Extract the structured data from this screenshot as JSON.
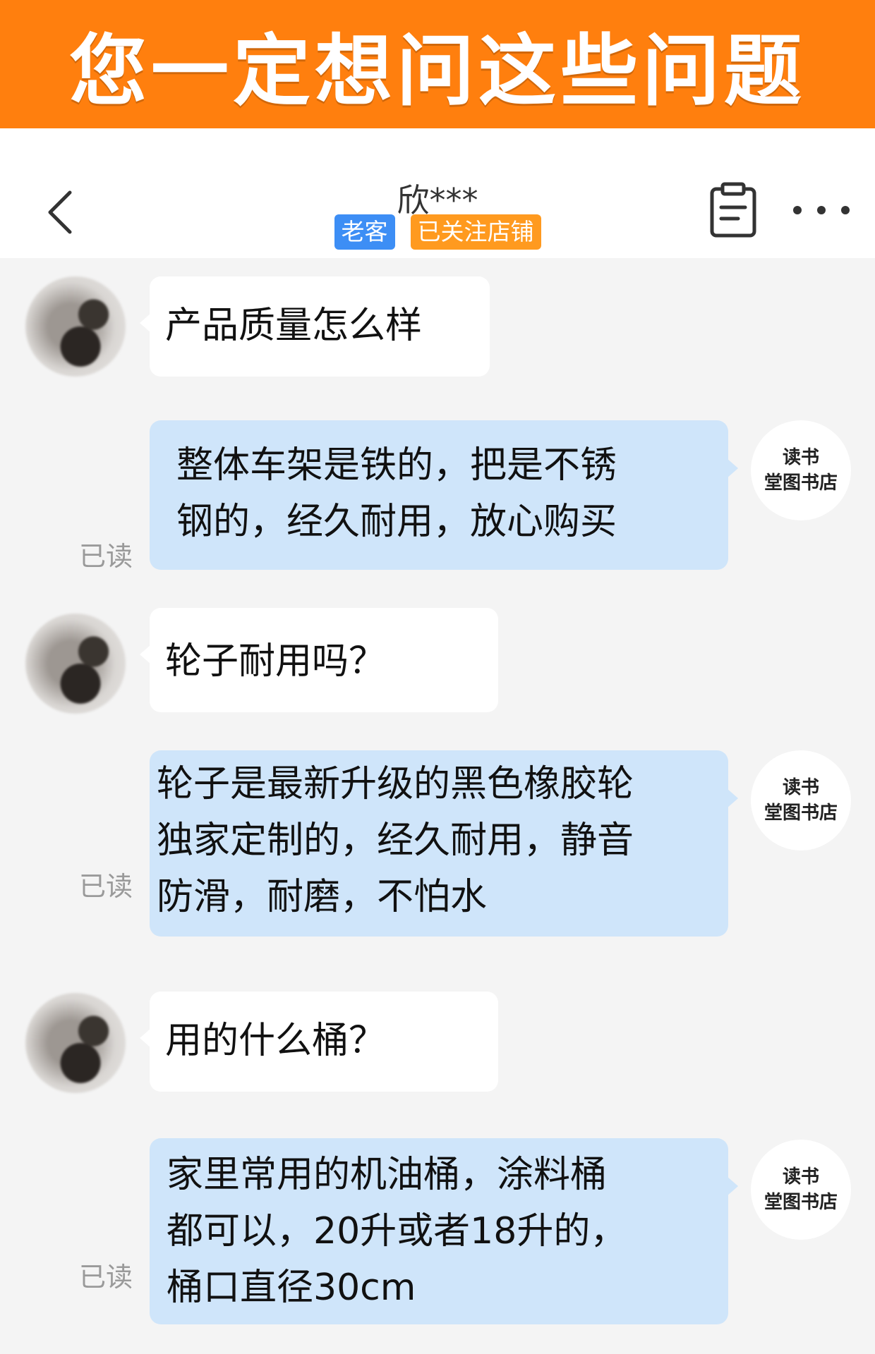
{
  "banner": {
    "title": "您一定想问这些问题"
  },
  "header": {
    "back_icon": "chevron-left-icon",
    "contact_name": "欣***",
    "tags": [
      {
        "label": "老客",
        "color": "#3d8ef5"
      },
      {
        "label": "已关注店铺",
        "color": "#ff9a1f"
      }
    ],
    "clipboard_icon": "clipboard-icon",
    "more_icon": "more-dots-icon"
  },
  "shop": {
    "avatar_line1": "读书",
    "avatar_line2": "堂图书店"
  },
  "read_label": "已读",
  "messages": [
    {
      "from": "customer",
      "text": "产品质量怎么样"
    },
    {
      "from": "shop",
      "lines": [
        "整体车架是铁的，把是不锈",
        "钢的，经久耐用，放心购买"
      ]
    },
    {
      "from": "customer",
      "text": "轮子耐用吗？"
    },
    {
      "from": "shop",
      "lines": [
        "轮子是最新升级的黑色橡胶轮",
        "独家定制的，经久耐用，静音",
        "防滑，耐磨，不怕水"
      ]
    },
    {
      "from": "customer",
      "text": "用的什么桶？"
    },
    {
      "from": "shop",
      "lines": [
        "家里常用的机油桶，涂料桶",
        "都可以，20升或者18升的，",
        "桶口直径30cm"
      ]
    }
  ],
  "colors": {
    "banner": "#ff7f0e",
    "outgoing_bubble": "#cfe5fa",
    "incoming_bubble": "#ffffff",
    "background": "#f4f4f4"
  }
}
